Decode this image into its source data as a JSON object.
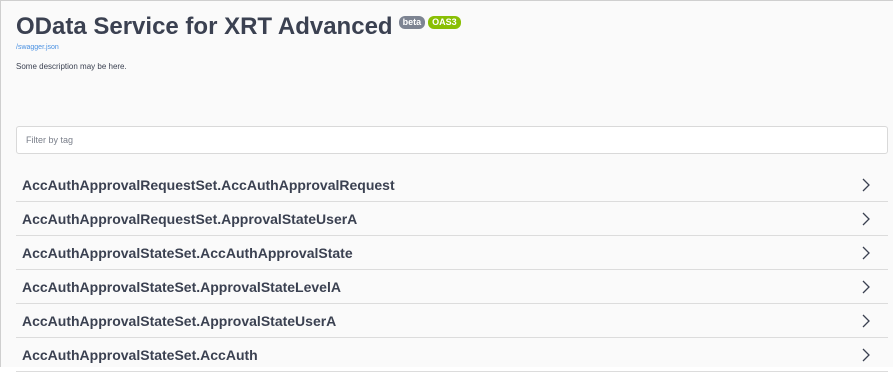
{
  "info": {
    "title": "OData Service for XRT Advanced",
    "badges": {
      "version": "beta",
      "spec": "OAS3"
    },
    "url_link": "/swagger.json",
    "description": "Some description may be here."
  },
  "filter": {
    "placeholder": "Filter by tag",
    "value": ""
  },
  "tags": [
    {
      "label": "AccAuthApprovalRequestSet.AccAuthApprovalRequest",
      "icon": "chevron-right-icon"
    },
    {
      "label": "AccAuthApprovalRequestSet.ApprovalStateUserA",
      "icon": "chevron-right-icon"
    },
    {
      "label": "AccAuthApprovalStateSet.AccAuthApprovalState",
      "icon": "chevron-right-icon"
    },
    {
      "label": "AccAuthApprovalStateSet.ApprovalStateLevelA",
      "icon": "chevron-right-icon"
    },
    {
      "label": "AccAuthApprovalStateSet.ApprovalStateUserA",
      "icon": "chevron-right-icon"
    },
    {
      "label": "AccAuthApprovalStateSet.AccAuth",
      "icon": "chevron-right-icon"
    }
  ],
  "colors": {
    "text": "#3b4151",
    "link": "#4990e2",
    "badge_beta": "#7d8492",
    "badge_oas3": "#89bf04"
  }
}
